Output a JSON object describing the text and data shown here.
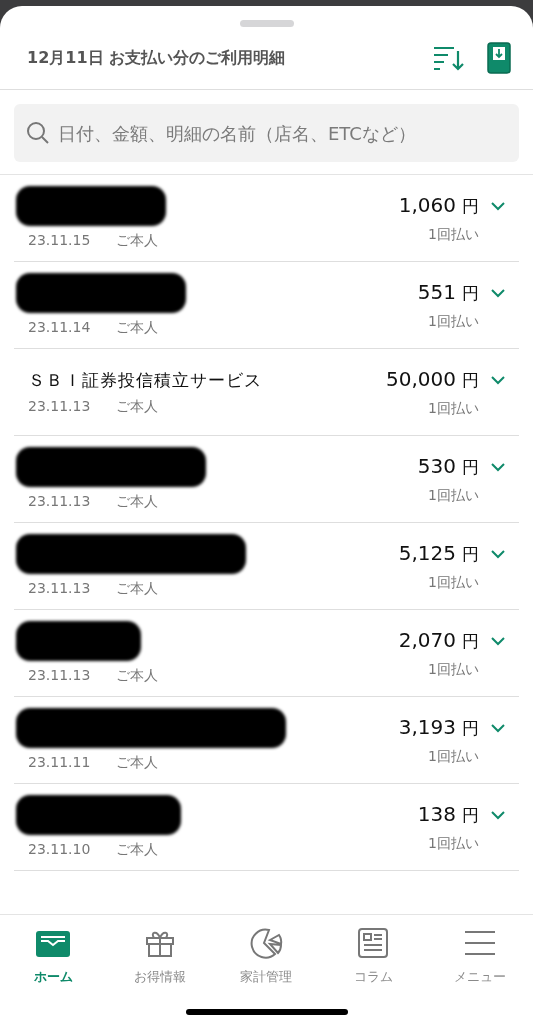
{
  "header": {
    "title": "12月11日 お支払い分のご利用明細"
  },
  "search": {
    "placeholder": "日付、金額、明細の名前（店名、ETCなど）"
  },
  "transactions": [
    {
      "kind": "redacted",
      "date": "23.11.15",
      "user": "ご本人",
      "amount": "1,060",
      "currency": "円",
      "plan": "1回払い"
    },
    {
      "kind": "redacted",
      "date": "23.11.14",
      "user": "ご本人",
      "amount": "551",
      "currency": "円",
      "plan": "1回払い"
    },
    {
      "kind": "named",
      "name": "ＳＢＩ証券投信積立サービス",
      "date": "23.11.13",
      "user": "ご本人",
      "amount": "50,000",
      "currency": "円",
      "plan": "1回払い"
    },
    {
      "kind": "redacted",
      "date": "23.11.13",
      "user": "ご本人",
      "amount": "530",
      "currency": "円",
      "plan": "1回払い"
    },
    {
      "kind": "redacted",
      "date": "23.11.13",
      "user": "ご本人",
      "amount": "5,125",
      "currency": "円",
      "plan": "1回払い"
    },
    {
      "kind": "redacted",
      "date": "23.11.13",
      "user": "ご本人",
      "amount": "2,070",
      "currency": "円",
      "plan": "1回払い"
    },
    {
      "kind": "redacted",
      "date": "23.11.11",
      "user": "ご本人",
      "amount": "3,193",
      "currency": "円",
      "plan": "1回払い"
    },
    {
      "kind": "redacted",
      "date": "23.11.10",
      "user": "ご本人",
      "amount": "138",
      "currency": "円",
      "plan": "1回払い"
    }
  ],
  "tab_bar": [
    {
      "kind": "home",
      "label": "ホーム",
      "selected": true
    },
    {
      "kind": "gift",
      "label": "お得情報",
      "selected": false
    },
    {
      "kind": "chart",
      "label": "家計管理",
      "selected": false
    },
    {
      "kind": "column",
      "label": "コラム",
      "selected": false
    },
    {
      "kind": "menu",
      "label": "メニュー",
      "selected": false
    }
  ]
}
